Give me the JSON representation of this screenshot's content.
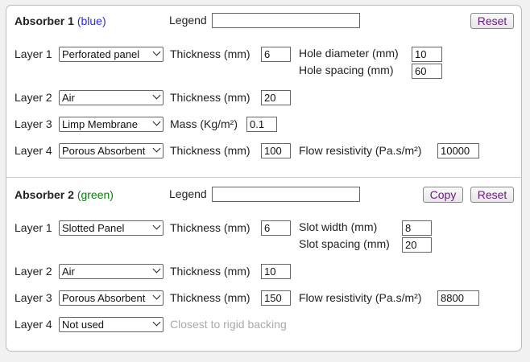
{
  "absorber1": {
    "title": "Absorber 1",
    "color_label": "(blue)",
    "legend_label": "Legend",
    "legend_value": "",
    "reset_label": "Reset",
    "layers": [
      {
        "label": "Layer 1",
        "type": "Perforated panel",
        "fields": [
          {
            "label": "Thickness (mm)",
            "value": "6"
          }
        ],
        "extra": [
          {
            "label": "Hole diameter (mm)",
            "value": "10"
          },
          {
            "label": "Hole spacing (mm)",
            "value": "60"
          }
        ]
      },
      {
        "label": "Layer 2",
        "type": "Air",
        "fields": [
          {
            "label": "Thickness (mm)",
            "value": "20"
          }
        ]
      },
      {
        "label": "Layer 3",
        "type": "Limp Membrane",
        "fields": [
          {
            "label": "Mass (Kg/m²)",
            "value": "0.1"
          }
        ]
      },
      {
        "label": "Layer 4",
        "type": "Porous Absorbent",
        "fields": [
          {
            "label": "Thickness (mm)",
            "value": "100"
          }
        ],
        "extra": [
          {
            "label": "Flow resistivity (Pa.s/m²)",
            "value": "10000"
          }
        ]
      }
    ]
  },
  "absorber2": {
    "title": "Absorber 2",
    "color_label": "(green)",
    "legend_label": "Legend",
    "legend_value": "",
    "copy_label": "Copy",
    "reset_label": "Reset",
    "layers": [
      {
        "label": "Layer 1",
        "type": "Slotted Panel",
        "fields": [
          {
            "label": "Thickness (mm)",
            "value": "6"
          }
        ],
        "extra": [
          {
            "label": "Slot width (mm)",
            "value": "8"
          },
          {
            "label": "Slot spacing (mm)",
            "value": "20"
          }
        ]
      },
      {
        "label": "Layer 2",
        "type": "Air",
        "fields": [
          {
            "label": "Thickness (mm)",
            "value": "10"
          }
        ]
      },
      {
        "label": "Layer 3",
        "type": "Porous Absorbent",
        "fields": [
          {
            "label": "Thickness (mm)",
            "value": "150"
          }
        ],
        "extra": [
          {
            "label": "Flow resistivity (Pa.s/m²)",
            "value": "8800"
          }
        ]
      },
      {
        "label": "Layer 4",
        "type": "Not used",
        "note": "Closest to rigid backing"
      }
    ]
  },
  "colors": {
    "accent_blue": "#2b2bd6",
    "accent_green": "#0a7d0a",
    "button_text": "#6a1b7a"
  }
}
